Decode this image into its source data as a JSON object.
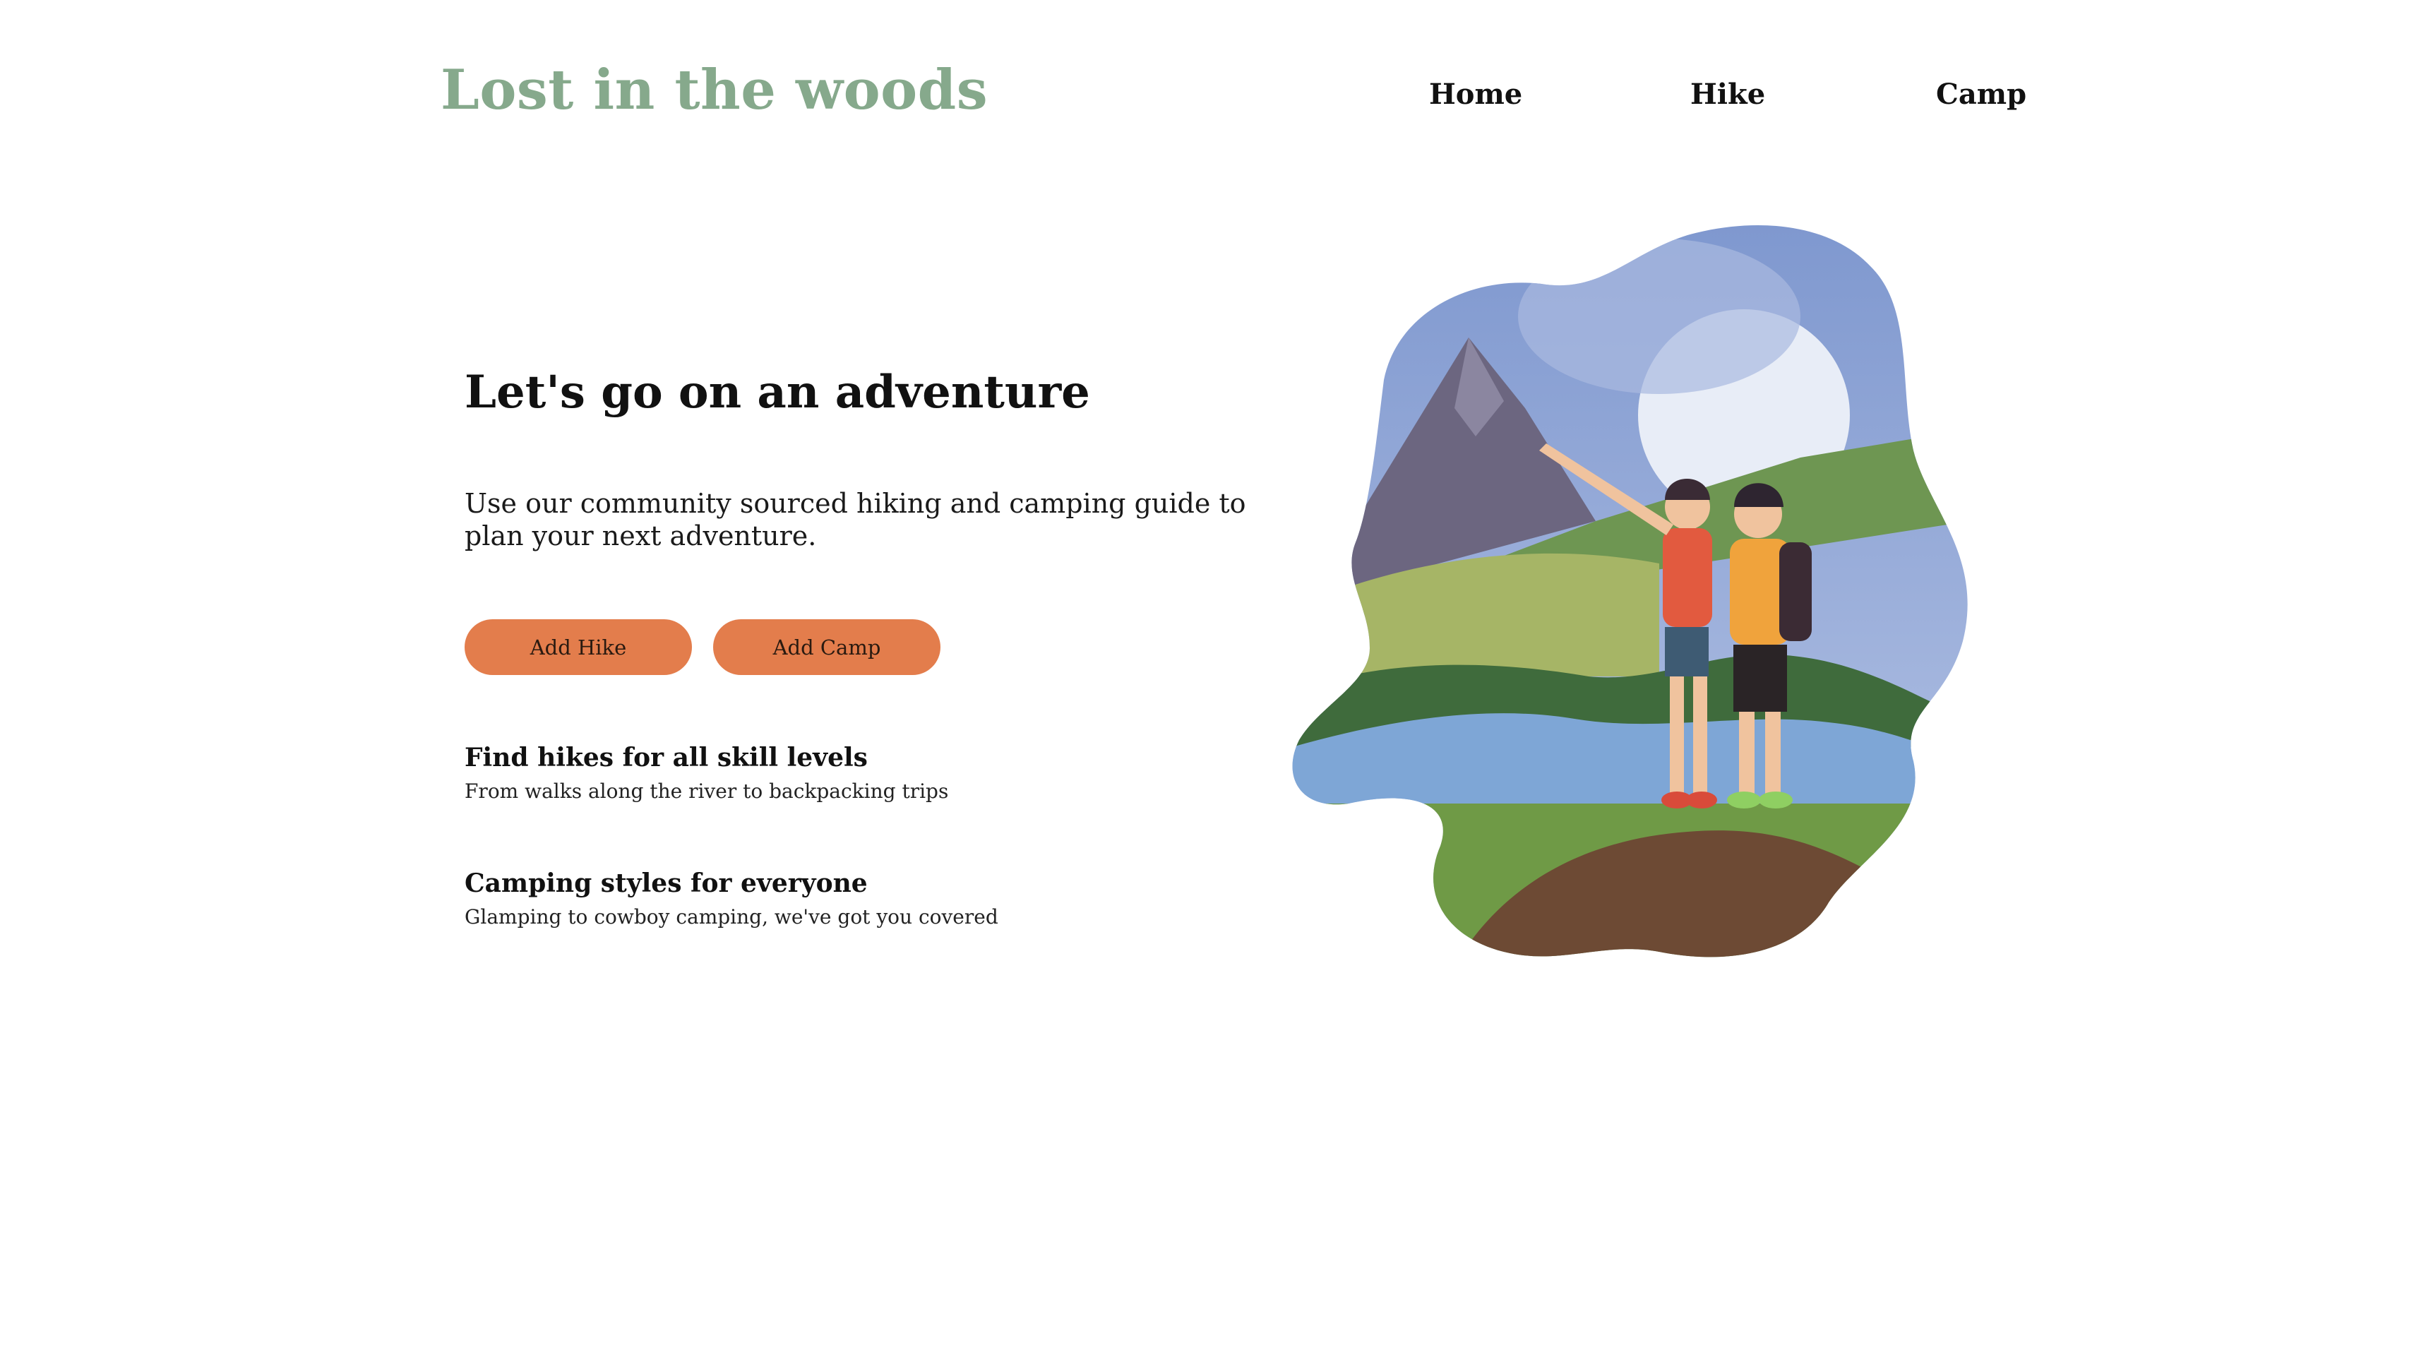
{
  "header": {
    "logo": "Lost in the woods",
    "nav": [
      {
        "label": "Home"
      },
      {
        "label": "Hike"
      },
      {
        "label": "Camp"
      }
    ]
  },
  "hero": {
    "title": "Let's go on an adventure",
    "text": "Use our community sourced hiking and camping guide to plan your next adventure.",
    "buttons": {
      "add_hike": "Add Hike",
      "add_camp": "Add Camp"
    }
  },
  "features": [
    {
      "title": "Find hikes for all skill levels",
      "subtitle": "From walks along the river to backpacking trips"
    },
    {
      "title": "Camping styles for everyone",
      "subtitle": "Glamping to cowboy camping, we've got you covered"
    }
  ],
  "colors": {
    "brand": "#86a98c",
    "button": "#e37d4c"
  }
}
